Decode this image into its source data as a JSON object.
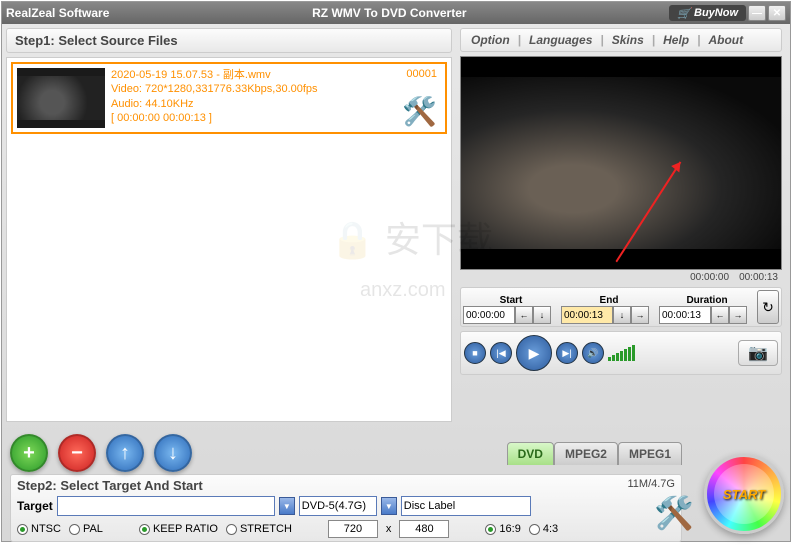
{
  "titlebar": {
    "company": "RealZeal Software",
    "title": "RZ WMV To DVD Converter",
    "buynow": "BuyNow"
  },
  "menu": {
    "option": "Option",
    "languages": "Languages",
    "skins": "Skins",
    "help": "Help",
    "about": "About"
  },
  "step1": {
    "header": "Step1: Select Source Files"
  },
  "file": {
    "name": "2020-05-19 15.07.53 - 副本.wmv",
    "video": "Video: 720*1280,331776.33Kbps,30.00fps",
    "audio": "Audio: 44.10KHz",
    "time": "[ 00:00:00   00:00:13 ]",
    "num": "00001"
  },
  "preview": {
    "curtime": "00:00:00",
    "duration": "00:00:13"
  },
  "trim": {
    "start_label": "Start",
    "start": "00:00:00",
    "end_label": "End",
    "end": "00:00:13",
    "dur_label": "Duration",
    "dur": "00:00:13"
  },
  "tabs": {
    "dvd": "DVD",
    "mpeg2": "MPEG2",
    "mpeg1": "MPEG1"
  },
  "step2": {
    "header": "Step2: Select Target And Start",
    "size": "11M/4.7G",
    "target_label": "Target",
    "dvd_size": "DVD-5(4.7G)",
    "disc_label": "Disc Label",
    "ntsc": "NTSC",
    "pal": "PAL",
    "keep": "KEEP RATIO",
    "stretch": "STRETCH",
    "w": "720",
    "x": "x",
    "h": "480",
    "r169": "16:9",
    "r43": "4:3"
  },
  "start": "START"
}
